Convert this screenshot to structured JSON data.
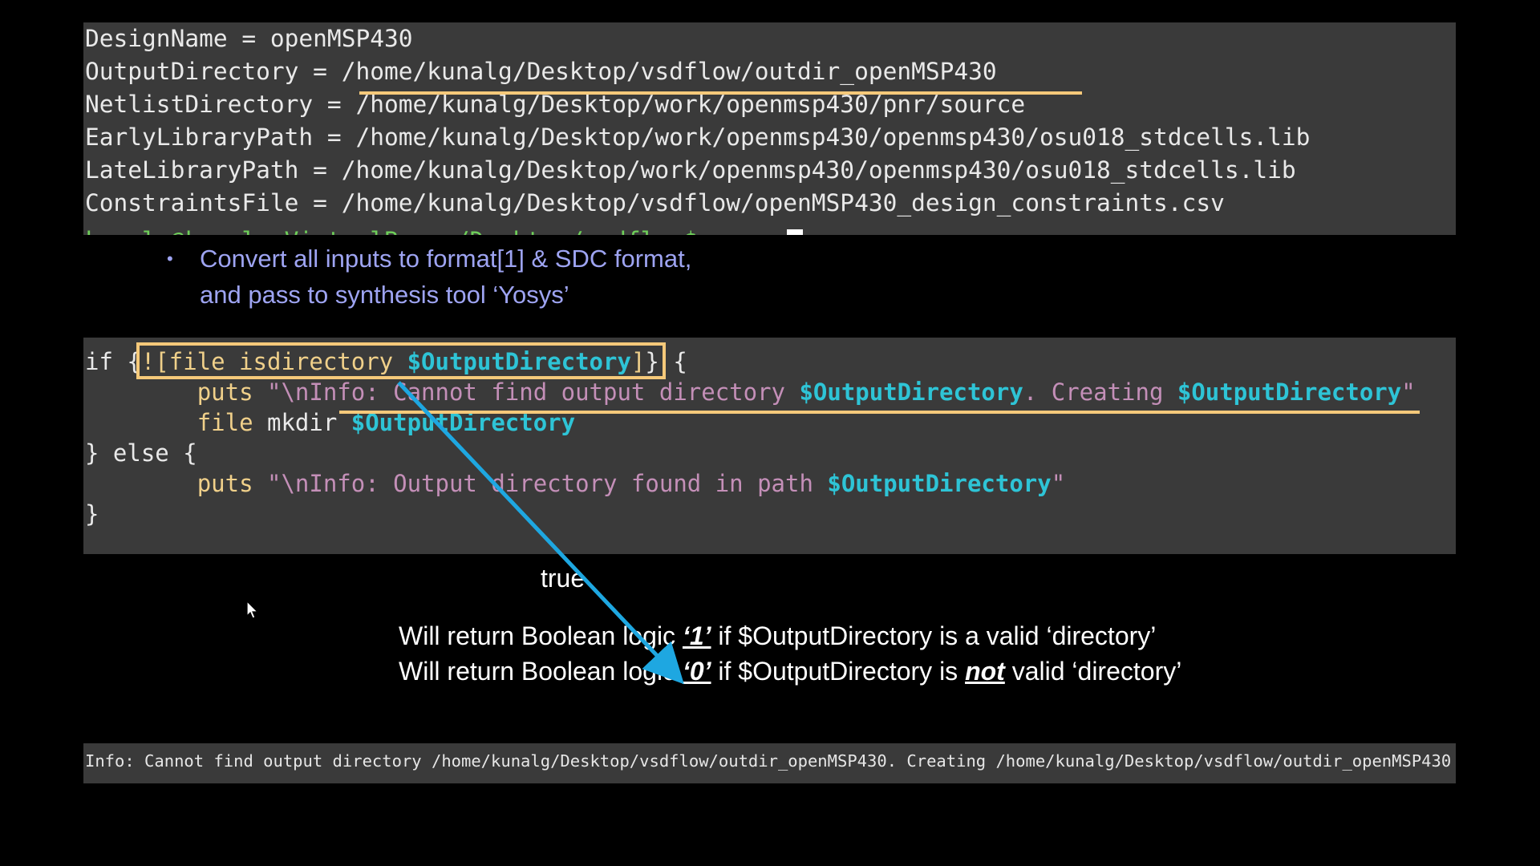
{
  "top_terminal": {
    "lines": [
      "DesignName = openMSP430",
      "OutputDirectory = /home/kunalg/Desktop/vsdflow/outdir_openMSP430",
      "NetlistDirectory = /home/kunalg/Desktop/work/openmsp430/pnr/source",
      "EarlyLibraryPath = /home/kunalg/Desktop/work/openmsp430/openmsp430/osu018_stdcells.lib",
      "LateLibraryPath = /home/kunalg/Desktop/work/openmsp430/openmsp430/osu018_stdcells.lib",
      "ConstraintsFile = /home/kunalg/Desktop/vsdflow/openMSP430_design_constraints.csv"
    ],
    "cut_prompt": "kunalg@kunalg-VirtualBox:~/Desktop/vsdflow$ "
  },
  "bullet": {
    "marker": "•",
    "line1": "Convert all inputs to format[1] & SDC format,",
    "line2": "and pass to synthesis tool ‘Yosys’"
  },
  "code": {
    "l1_if": "if {",
    "l1_cond_a": "![file isdirectory ",
    "l1_cond_var": "$OutputDirectory",
    "l1_cond_b": "]",
    "l1_end": "} {",
    "l2_indent": "        ",
    "l2_cmd": "puts",
    "l2_str_a": " \"\\nInfo: Cannot find output directory ",
    "l2_var1": "$OutputDirectory",
    "l2_str_b": ". Creating ",
    "l2_var2": "$OutputDirectory",
    "l2_str_c": "\"",
    "l3_indent": "        ",
    "l3_cmd": "file",
    "l3_kw": " mkdir ",
    "l3_var": "$OutputDirectory",
    "l4": "} else {",
    "l5_indent": "        ",
    "l5_cmd": "puts",
    "l5_str_a": " \"\\nInfo: Output directory found in path ",
    "l5_var": "$OutputDirectory",
    "l5_str_b": "\"",
    "l6": "}"
  },
  "true_label": "true",
  "notes": {
    "n1_a": "Will return Boolean logic ",
    "n1_b": "‘1’",
    "n1_c": " if $OutputDirectory is a valid ‘directory’",
    "n2_a": "Will return Boolean logic ",
    "n2_b": "‘0’",
    "n2_c": " if $OutputDirectory is ",
    "n2_d": "not",
    "n2_e": " valid ‘directory’"
  },
  "bottom_terminal": {
    "text": "Info: Cannot find output directory /home/kunalg/Desktop/vsdflow/outdir_openMSP430. Creating /home/kunalg/Desktop/vsdflow/outdir_openMSP430"
  },
  "colors": {
    "highlight": "#f5c97a",
    "arrow": "#1ea7e1",
    "variable": "#2ec4d6",
    "bullet_text": "#9ea4f2"
  }
}
